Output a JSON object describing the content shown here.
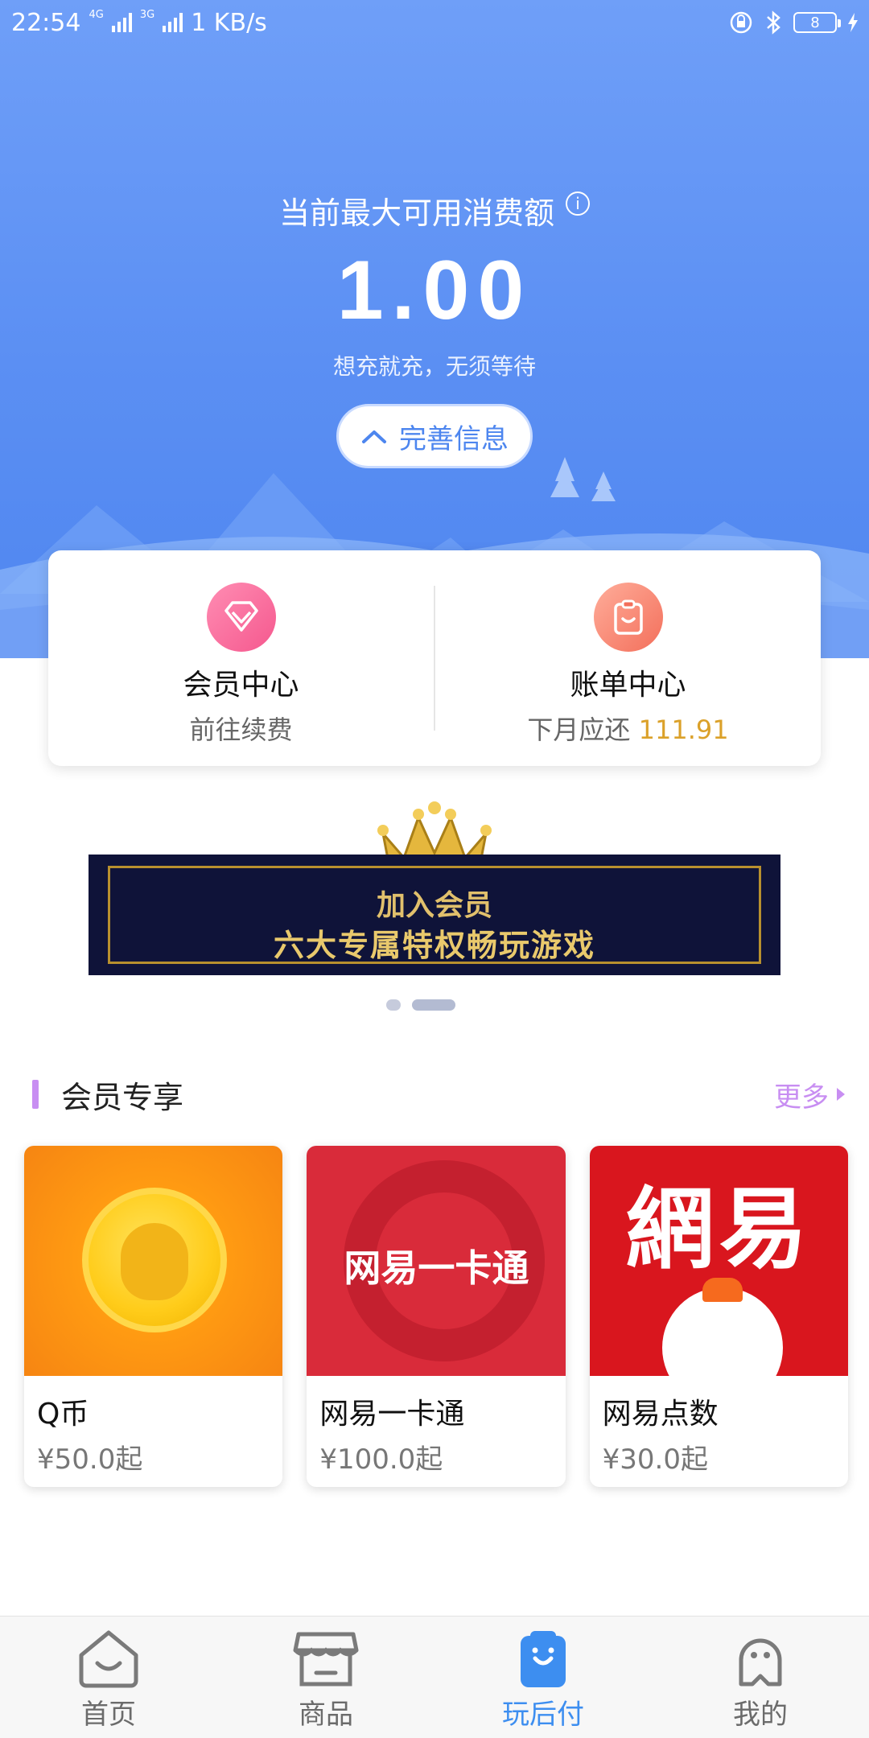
{
  "status_bar": {
    "time": "22:54",
    "net1": "4G",
    "net2": "3G",
    "speed": "1 KB/s",
    "battery": "8"
  },
  "hero": {
    "title": "当前最大可用消费额",
    "info_glyph": "i",
    "amount": "1.00",
    "subtitle": "想充就充，无须等待",
    "complete_button": "完善信息"
  },
  "cards": {
    "member": {
      "title": "会员中心",
      "subtitle": "前往续费",
      "icon": "diamond-icon"
    },
    "bill": {
      "title": "账单中心",
      "subtitle_prefix": "下月应还",
      "amount": "111.91",
      "icon": "clipboard-icon"
    }
  },
  "banner": {
    "line1": "加入会员",
    "line2": "六大专属特权畅玩游戏",
    "slides": 2,
    "active_slide": 2
  },
  "section": {
    "title": "会员专享",
    "more": "更多"
  },
  "products": [
    {
      "name": "Q币",
      "price": "¥50.0起",
      "image": "q-coin"
    },
    {
      "name": "网易一卡通",
      "price": "¥100.0起",
      "image_text": "网易一卡通"
    },
    {
      "name": "网易点数",
      "price": "¥30.0起",
      "image_text": "網易"
    }
  ],
  "bottom_nav": [
    {
      "label": "首页",
      "icon": "home-icon"
    },
    {
      "label": "商品",
      "icon": "store-icon"
    },
    {
      "label": "玩后付",
      "icon": "bag-icon",
      "active": true
    },
    {
      "label": "我的",
      "icon": "profile-icon"
    }
  ],
  "colors": {
    "hero_blue": "#5b8ff3",
    "accent_purple": "#c88ef2",
    "amount_gold": "#dba12a",
    "nav_active": "#3d8ef0"
  }
}
